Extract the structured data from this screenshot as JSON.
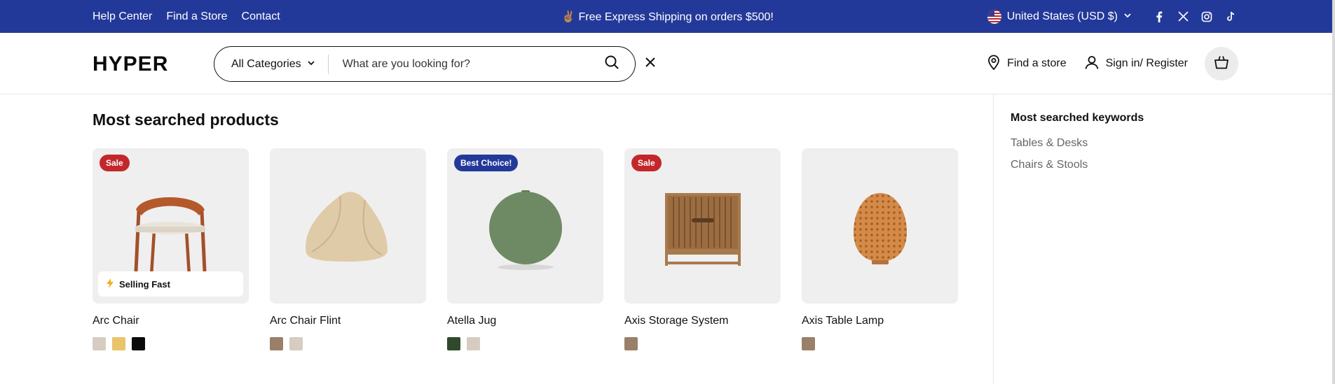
{
  "topbar": {
    "links": [
      "Help Center",
      "Find a Store",
      "Contact"
    ],
    "promo_text": "✌🏽 Free Express Shipping on orders $500!",
    "country": "United States (USD $)",
    "social": [
      "facebook-icon",
      "x-icon",
      "instagram-icon",
      "tiktok-icon"
    ]
  },
  "header": {
    "logo": "HYPER",
    "category_select": "All Categories",
    "search_placeholder": "What are you looking for?",
    "find_store": "Find a store",
    "sign_in": "Sign in/ Register"
  },
  "main": {
    "title": "Most searched products",
    "products": [
      {
        "name": "Arc Chair",
        "badge": "Sale",
        "badge_type": "sale",
        "selling": "Selling Fast",
        "swatches": [
          "#d6ccc2",
          "#e9c46a",
          "#0a0a0a"
        ]
      },
      {
        "name": "Arc Chair Flint",
        "badge": "",
        "badge_type": "",
        "swatches": [
          "#9a8068",
          "#d6ccc2"
        ]
      },
      {
        "name": "Atella Jug",
        "badge": "Best Choice!",
        "badge_type": "best",
        "swatches": [
          "#2f4a2a",
          "#d6ccc2"
        ]
      },
      {
        "name": "Axis Storage System",
        "badge": "Sale",
        "badge_type": "sale",
        "swatches": [
          "#9a8068"
        ]
      },
      {
        "name": "Axis Table Lamp",
        "badge": "",
        "badge_type": "",
        "swatches": [
          "#9a8068"
        ]
      }
    ]
  },
  "sidebar": {
    "title": "Most searched keywords",
    "keywords": [
      "Tables & Desks",
      "Chairs & Stools"
    ]
  },
  "colors": {
    "brand_blue": "#23399a",
    "sale_red": "#c3272b"
  }
}
